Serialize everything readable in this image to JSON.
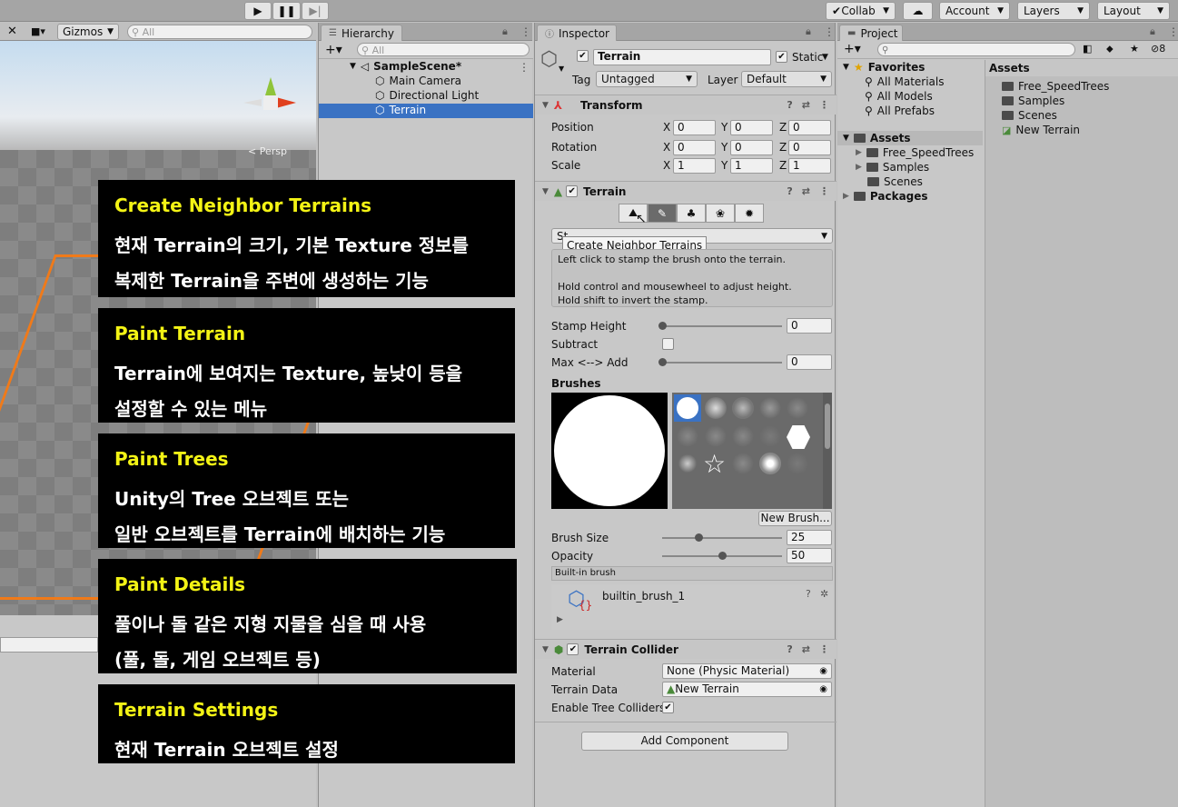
{
  "toolbar": {
    "collab": "Collab",
    "account": "Account",
    "layers": "Layers",
    "layout": "Layout"
  },
  "scene": {
    "gizmos": "Gizmos",
    "search_placeholder": "All",
    "persp": "< Persp"
  },
  "hierarchy": {
    "tab": "Hierarchy",
    "search_placeholder": "All",
    "scene_name": "SampleScene*",
    "items": [
      "Main Camera",
      "Directional Light",
      "Terrain"
    ]
  },
  "inspector": {
    "tab": "Inspector",
    "object_name": "Terrain",
    "static_label": "Static",
    "tag_label": "Tag",
    "tag_value": "Untagged",
    "layer_label": "Layer",
    "layer_value": "Default",
    "transform": {
      "title": "Transform",
      "rows": [
        {
          "label": "Position",
          "x": "0",
          "y": "0",
          "z": "0"
        },
        {
          "label": "Rotation",
          "x": "0",
          "y": "0",
          "z": "0"
        },
        {
          "label": "Scale",
          "x": "1",
          "y": "1",
          "z": "1"
        }
      ]
    },
    "terrain": {
      "title": "Terrain",
      "tooltip": "Create Neighbor Terrains",
      "mode_dropdown": "St",
      "help_line1": "Left click to stamp the brush onto the terrain.",
      "help_line2": "Hold control and mousewheel to adjust height.",
      "help_line3": "Hold shift to invert the stamp.",
      "stamp_height_label": "Stamp Height",
      "stamp_height_value": "0",
      "stamp_height_fraction": 0.0,
      "subtract_label": "Subtract",
      "max_add_label": "Max <--> Add",
      "max_add_value": "0",
      "max_add_fraction": 0.0,
      "brushes_label": "Brushes",
      "new_brush_button": "New Brush...",
      "brush_size_label": "Brush Size",
      "brush_size_value": "25",
      "brush_size_fraction": 0.3,
      "opacity_label": "Opacity",
      "opacity_value": "50",
      "opacity_fraction": 0.5,
      "builtin_label": "Built-in brush",
      "brush_asset": "builtin_brush_1"
    },
    "collider": {
      "title": "Terrain Collider",
      "material_label": "Material",
      "material_value": "None (Physic Material)",
      "data_label": "Terrain Data",
      "data_value": "New Terrain",
      "trees_label": "Enable Tree Colliders"
    },
    "add_component": "Add Component"
  },
  "project": {
    "tab": "Project",
    "favorites_label": "Favorites",
    "favorites": [
      "All Materials",
      "All Models",
      "All Prefabs"
    ],
    "assets_label": "Assets",
    "assets_tree": [
      "Free_SpeedTrees",
      "Samples",
      "Scenes"
    ],
    "packages_label": "Packages",
    "assets_header": "Assets",
    "assets_list": [
      "Free_SpeedTrees",
      "Samples",
      "Scenes",
      "New Terrain"
    ],
    "hidden_count": "8"
  },
  "annotations": [
    {
      "title": "Create Neighbor Terrains",
      "lines": [
        "현재 Terrain의 크기, 기본 Texture 정보를",
        "복제한 Terrain을 주변에 생성하는 기능"
      ]
    },
    {
      "title": "Paint Terrain",
      "lines": [
        "Terrain에 보여지는 Texture, 높낮이 등을",
        "설정할 수 있는 메뉴"
      ]
    },
    {
      "title": "Paint Trees",
      "lines": [
        "Unity의 Tree 오브젝트 또는",
        "일반 오브젝트를 Terrain에 배치하는 기능"
      ]
    },
    {
      "title": "Paint Details",
      "lines": [
        "풀이나 돌 같은 지형 지물을 심을 때 사용",
        "(풀, 돌, 게임 오브젝트 등)"
      ]
    },
    {
      "title": "Terrain Settings",
      "lines": [
        "현재 Terrain 오브젝트 설정"
      ]
    }
  ]
}
